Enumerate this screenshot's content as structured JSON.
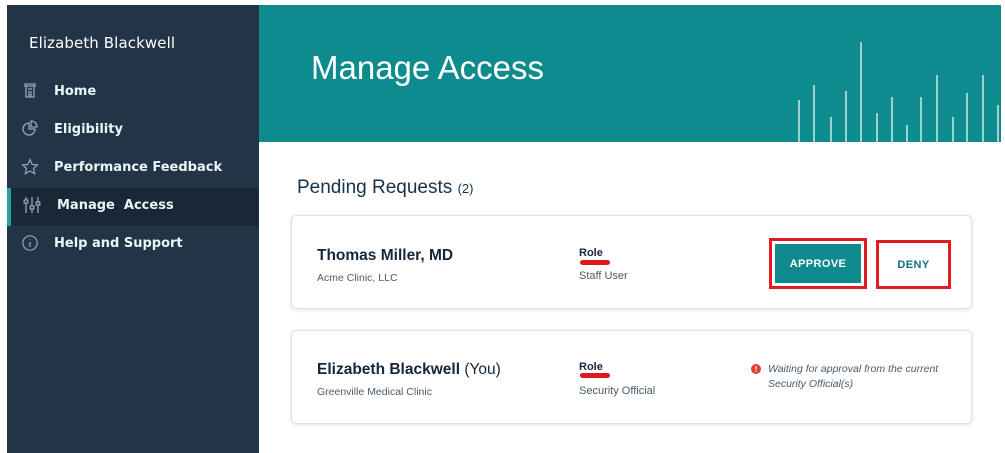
{
  "sidebar": {
    "user_name": "Elizabeth Blackwell",
    "items": [
      {
        "label": "Home",
        "icon": "home-icon"
      },
      {
        "label": "Eligibility",
        "icon": "pie-chart-icon"
      },
      {
        "label": "Performance Feedback",
        "icon": "star-icon"
      },
      {
        "label": "Manage  Access",
        "icon": "sliders-icon",
        "active": true
      },
      {
        "label": "Help and Support",
        "icon": "info-icon"
      }
    ]
  },
  "header": {
    "title": "Manage Access"
  },
  "main": {
    "section_title": "Pending Requests",
    "section_count": "(2)",
    "requests": [
      {
        "name": "Thomas Miller, MD",
        "organization": "Acme Clinic, LLC",
        "role_label": "Role",
        "role_value": "Staff User",
        "approve_label": "APPROVE",
        "deny_label": "DENY"
      },
      {
        "name": "Elizabeth Blackwell",
        "name_suffix": "(You)",
        "organization": "Greenville Medical Clinic",
        "role_label": "Role",
        "role_value": "Security Official",
        "status_text": "Waiting for approval from the current Security Official(s)"
      }
    ]
  },
  "colors": {
    "sidebar_bg": "#243447",
    "header_bg": "#0e8b8d",
    "accent": "#0f8a8c",
    "highlight": "#e01b24"
  }
}
